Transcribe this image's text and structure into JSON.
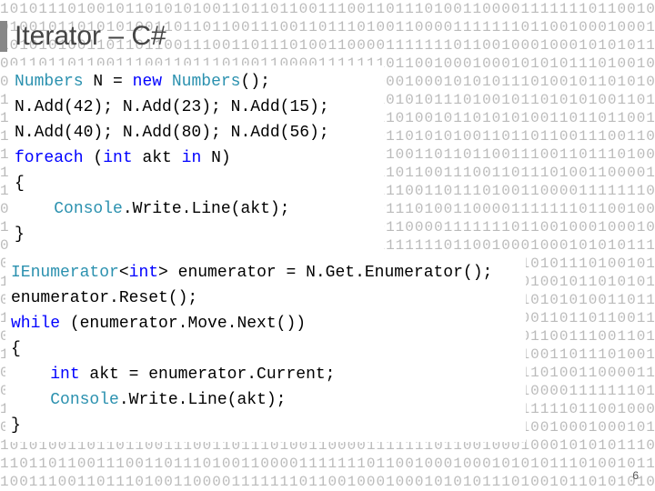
{
  "title": "Iterator – C#",
  "page_number": "6",
  "binary_background_row": "1010111010010110101010011011011001110011011101001100001111111011001000100010",
  "code_block_1": {
    "lines": [
      [
        {
          "cls": "t",
          "text": "Numbers"
        },
        {
          "cls": "n",
          "text": " N = "
        },
        {
          "cls": "k",
          "text": "new"
        },
        {
          "cls": "n",
          "text": " "
        },
        {
          "cls": "t",
          "text": "Numbers"
        },
        {
          "cls": "n",
          "text": "();"
        }
      ],
      [
        {
          "cls": "n",
          "text": "N.Add(42); N.Add(23); N.Add(15);"
        }
      ],
      [
        {
          "cls": "n",
          "text": "N.Add(40); N.Add(80); N.Add(56);"
        }
      ],
      [
        {
          "cls": "k",
          "text": "foreach"
        },
        {
          "cls": "n",
          "text": " ("
        },
        {
          "cls": "k",
          "text": "int"
        },
        {
          "cls": "n",
          "text": " akt "
        },
        {
          "cls": "k",
          "text": "in"
        },
        {
          "cls": "n",
          "text": " N)"
        }
      ],
      [
        {
          "cls": "n",
          "text": "{"
        }
      ],
      [
        {
          "cls": "n",
          "text": "    "
        },
        {
          "cls": "t",
          "text": "Console"
        },
        {
          "cls": "n",
          "text": ".Write.Line(akt);"
        }
      ],
      [
        {
          "cls": "n",
          "text": "}"
        }
      ]
    ]
  },
  "code_block_2": {
    "lines": [
      [
        {
          "cls": "t",
          "text": "IEnumerator"
        },
        {
          "cls": "n",
          "text": "<"
        },
        {
          "cls": "k",
          "text": "int"
        },
        {
          "cls": "n",
          "text": "> enumerator = N.Get.Enumerator();"
        }
      ],
      [
        {
          "cls": "n",
          "text": "enumerator.Reset();"
        }
      ],
      [
        {
          "cls": "k",
          "text": "while"
        },
        {
          "cls": "n",
          "text": " (enumerator.Move.Next())"
        }
      ],
      [
        {
          "cls": "n",
          "text": "{"
        }
      ],
      [
        {
          "cls": "n",
          "text": "    "
        },
        {
          "cls": "k",
          "text": "int"
        },
        {
          "cls": "n",
          "text": " akt = enumerator.Current;"
        }
      ],
      [
        {
          "cls": "n",
          "text": "    "
        },
        {
          "cls": "t",
          "text": "Console"
        },
        {
          "cls": "n",
          "text": ".Write.Line(akt);"
        }
      ],
      [
        {
          "cls": "n",
          "text": "}"
        }
      ]
    ]
  }
}
